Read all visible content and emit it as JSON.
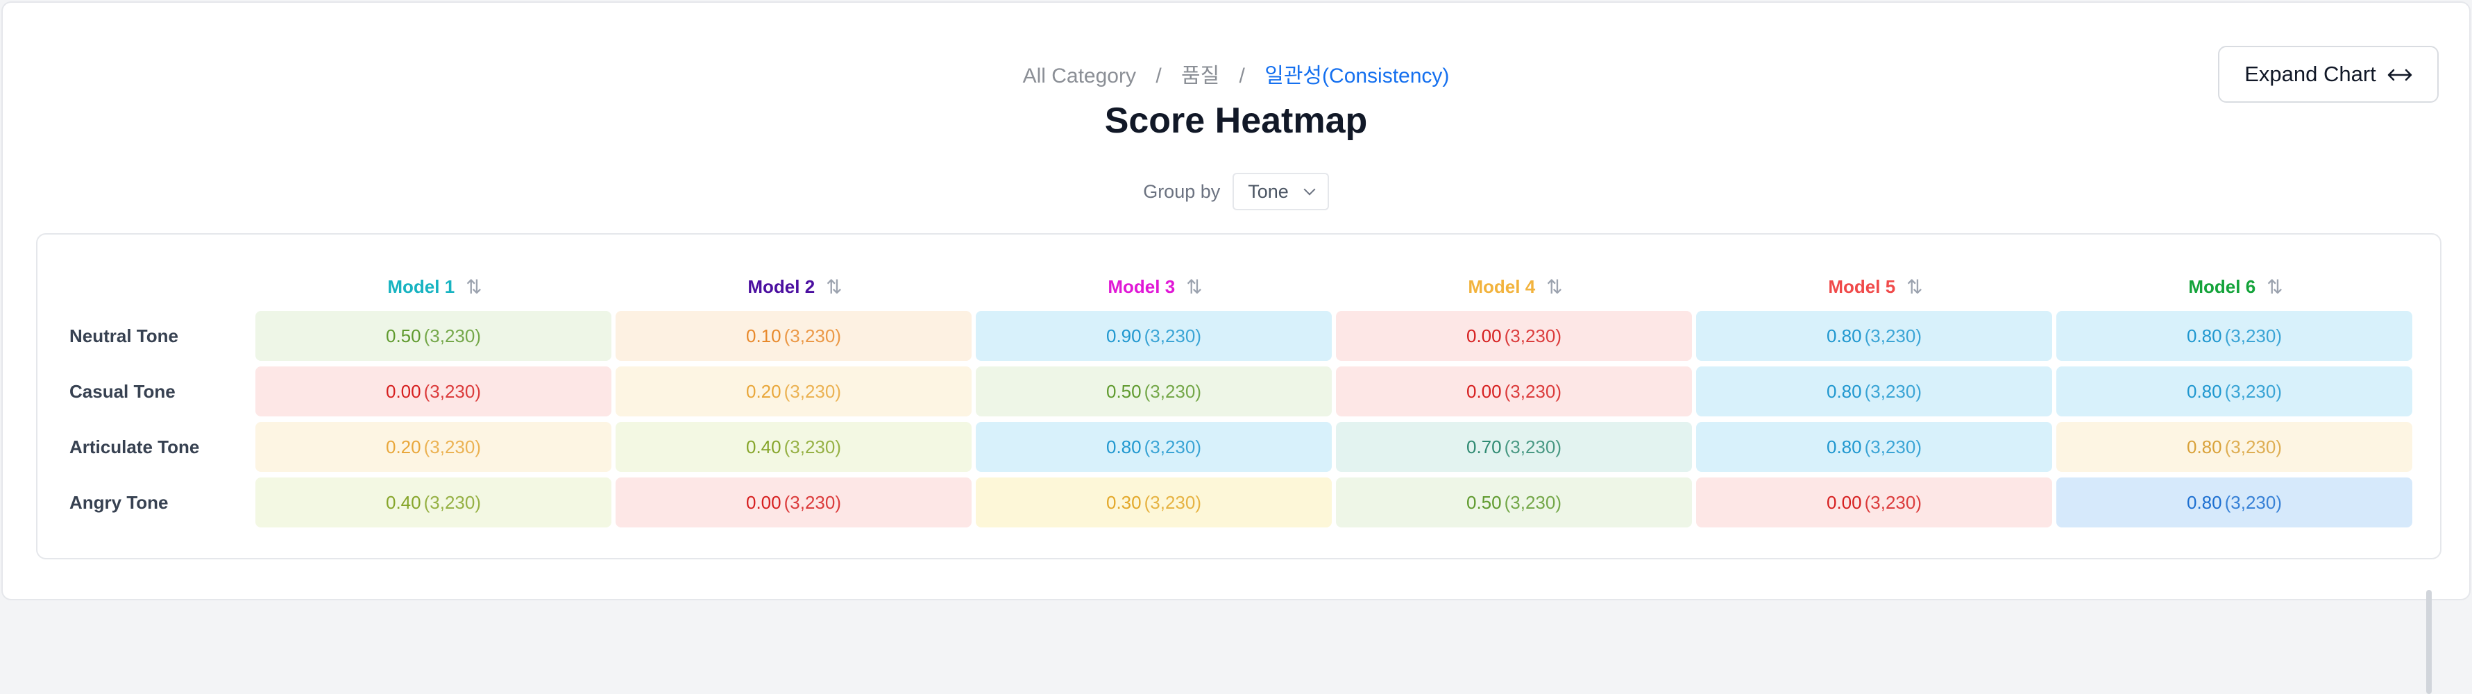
{
  "breadcrumb": {
    "root": "All Category",
    "sep1": "/",
    "middle": "품질",
    "sep2": "/",
    "current": "일관성(Consistency)"
  },
  "title": "Score Heatmap",
  "group_by": {
    "label": "Group by",
    "value": "Tone"
  },
  "expand_button": {
    "label": "Expand Chart",
    "icon": "arrows-horizontal-icon"
  },
  "sort_icon": "⇅",
  "models": [
    {
      "name": "Model 1",
      "color": "#17b3c1"
    },
    {
      "name": "Model 2",
      "color": "#4b0fa0"
    },
    {
      "name": "Model 3",
      "color": "#e018d6"
    },
    {
      "name": "Model 4",
      "color": "#f2b33d"
    },
    {
      "name": "Model 5",
      "color": "#f04a4a"
    },
    {
      "name": "Model 6",
      "color": "#14a33a"
    }
  ],
  "rows": [
    {
      "label": "Neutral Tone",
      "cells": [
        {
          "score": "0.50",
          "count": "(3,230)"
        },
        {
          "score": "0.10",
          "count": "(3,230)"
        },
        {
          "score": "0.90",
          "count": "(3,230)"
        },
        {
          "score": "0.00",
          "count": "(3,230)"
        },
        {
          "score": "0.80",
          "count": "(3,230)"
        },
        {
          "score": "0.80",
          "count": "(3,230)"
        }
      ]
    },
    {
      "label": "Casual Tone",
      "cells": [
        {
          "score": "0.00",
          "count": "(3,230)"
        },
        {
          "score": "0.20",
          "count": "(3,230)"
        },
        {
          "score": "0.50",
          "count": "(3,230)"
        },
        {
          "score": "0.00",
          "count": "(3,230)"
        },
        {
          "score": "0.80",
          "count": "(3,230)"
        },
        {
          "score": "0.80",
          "count": "(3,230)"
        }
      ]
    },
    {
      "label": "Articulate Tone",
      "cells": [
        {
          "score": "0.20",
          "count": "(3,230)"
        },
        {
          "score": "0.40",
          "count": "(3,230)"
        },
        {
          "score": "0.80",
          "count": "(3,230)"
        },
        {
          "score": "0.70",
          "count": "(3,230)"
        },
        {
          "score": "0.80",
          "count": "(3,230)"
        },
        {
          "score": "0.80",
          "count": "(3,230)"
        }
      ]
    },
    {
      "label": "Angry Tone",
      "cells": [
        {
          "score": "0.40",
          "count": "(3,230)"
        },
        {
          "score": "0.00",
          "count": "(3,230)"
        },
        {
          "score": "0.30",
          "count": "(3,230)"
        },
        {
          "score": "0.50",
          "count": "(3,230)"
        },
        {
          "score": "0.00",
          "count": "(3,230)"
        },
        {
          "score": "0.80",
          "count": "(3,230)"
        }
      ]
    }
  ],
  "cell_colors": [
    [
      {
        "bg": "#eef6e7",
        "fg": "#5f9a2e"
      },
      {
        "bg": "#fdf1e2",
        "fg": "#e8892b"
      },
      {
        "bg": "#d8f1fb",
        "fg": "#1f97cf"
      },
      {
        "bg": "#fde7e6",
        "fg": "#d61f1f"
      },
      {
        "bg": "#d8f1fb",
        "fg": "#1f97cf"
      },
      {
        "bg": "#d8f1fb",
        "fg": "#1f97cf"
      }
    ],
    [
      {
        "bg": "#fde7e6",
        "fg": "#d61f1f"
      },
      {
        "bg": "#fdf5e3",
        "fg": "#e9a73b"
      },
      {
        "bg": "#eef6e7",
        "fg": "#5f9a2e"
      },
      {
        "bg": "#fde7e6",
        "fg": "#d61f1f"
      },
      {
        "bg": "#d8f1fb",
        "fg": "#1f97cf"
      },
      {
        "bg": "#d8f1fb",
        "fg": "#1f97cf"
      }
    ],
    [
      {
        "bg": "#fdf5e3",
        "fg": "#e9a73b"
      },
      {
        "bg": "#f3f8e3",
        "fg": "#86a52a"
      },
      {
        "bg": "#d8f1fb",
        "fg": "#1f97cf"
      },
      {
        "bg": "#e3f3f0",
        "fg": "#2f8a72"
      },
      {
        "bg": "#d8f1fb",
        "fg": "#1f97cf"
      },
      {
        "bg": "#fdf5e3",
        "fg": "#d9a23a"
      }
    ],
    [
      {
        "bg": "#f3f8e3",
        "fg": "#86a52a"
      },
      {
        "bg": "#fde7e6",
        "fg": "#d61f1f"
      },
      {
        "bg": "#fdf7d8",
        "fg": "#e3a82a"
      },
      {
        "bg": "#eef6e7",
        "fg": "#5f9a2e"
      },
      {
        "bg": "#fde7e6",
        "fg": "#d61f1f"
      },
      {
        "bg": "#d6e9fb",
        "fg": "#1d6fd0"
      }
    ]
  ]
}
